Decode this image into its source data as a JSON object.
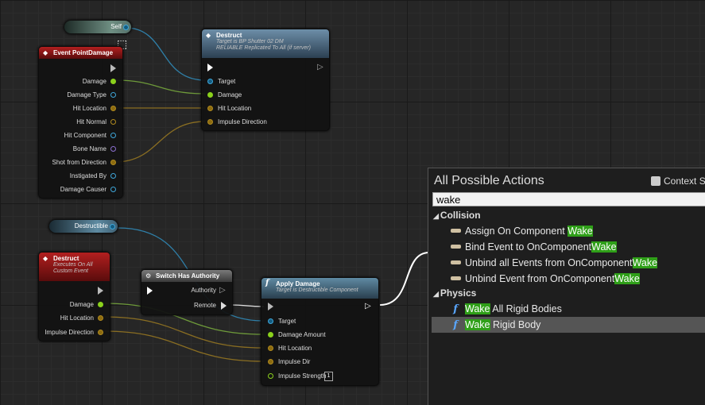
{
  "self_node": {
    "label": "Self"
  },
  "destructible_node": {
    "label": "Destructible"
  },
  "event_point_damage": {
    "title": "Event PointDamage",
    "pins": [
      "Damage",
      "Damage Type",
      "Hit Location",
      "Hit Normal",
      "Hit Component",
      "Bone Name",
      "Shot from Direction",
      "Instigated By",
      "Damage Causer"
    ]
  },
  "destruct_call": {
    "title": "Destruct",
    "subtitle1": "Target is BP Shutter 02 DM",
    "subtitle2": "RELIABLE Replicated To All (if server)",
    "pins": [
      "Target",
      "Damage",
      "Hit Location",
      "Impulse Direction"
    ]
  },
  "destruct_event": {
    "title": "Destruct",
    "subtitle1": "Executes On All",
    "subtitle2": "Custom Event",
    "pins": [
      "Damage",
      "Hit Location",
      "Impulse Direction"
    ]
  },
  "switch_authority": {
    "title": "Switch Has Authority",
    "pins": [
      "Authority",
      "Remote"
    ]
  },
  "apply_damage": {
    "title": "Apply Damage",
    "subtitle": "Target is Destructible Component",
    "pins": [
      "Target",
      "Damage Amount",
      "Hit Location",
      "Impulse Dir",
      "Impulse Strength"
    ],
    "impulse_strength_value": "1"
  },
  "actions_menu": {
    "title": "All Possible Actions",
    "context_label": "Context S",
    "search_value": "wake",
    "categories": [
      {
        "name": "Collision",
        "items": [
          {
            "pre": "Assign On Component ",
            "hl": "Wake",
            "post": ""
          },
          {
            "pre": "Bind Event to OnComponent",
            "hl": "Wake",
            "post": ""
          },
          {
            "pre": "Unbind all Events from OnComponent",
            "hl": "Wake",
            "post": ""
          },
          {
            "pre": "Unbind Event from OnComponent",
            "hl": "Wake",
            "post": ""
          }
        ]
      },
      {
        "name": "Physics",
        "items": [
          {
            "pre": "",
            "hl": "Wake",
            "post": " All Rigid Bodies"
          },
          {
            "pre": "",
            "hl": "Wake",
            "post": " Rigid Body"
          }
        ]
      }
    ],
    "selected_item": "Wake Rigid Body"
  },
  "colors": {
    "float_pin": "#8bd11c",
    "vector_pin": "#b08a1f",
    "object_pin": "#3fa6d9",
    "highlight": "#2f9f18",
    "event_header": "#b21f1f",
    "function_header": "#6d8ea8"
  },
  "icons": {
    "event": "diamond-icon",
    "function": "f-icon",
    "switch": "gear-icon",
    "component": "minus-bar-icon",
    "collapse": "triangle-down-icon"
  }
}
